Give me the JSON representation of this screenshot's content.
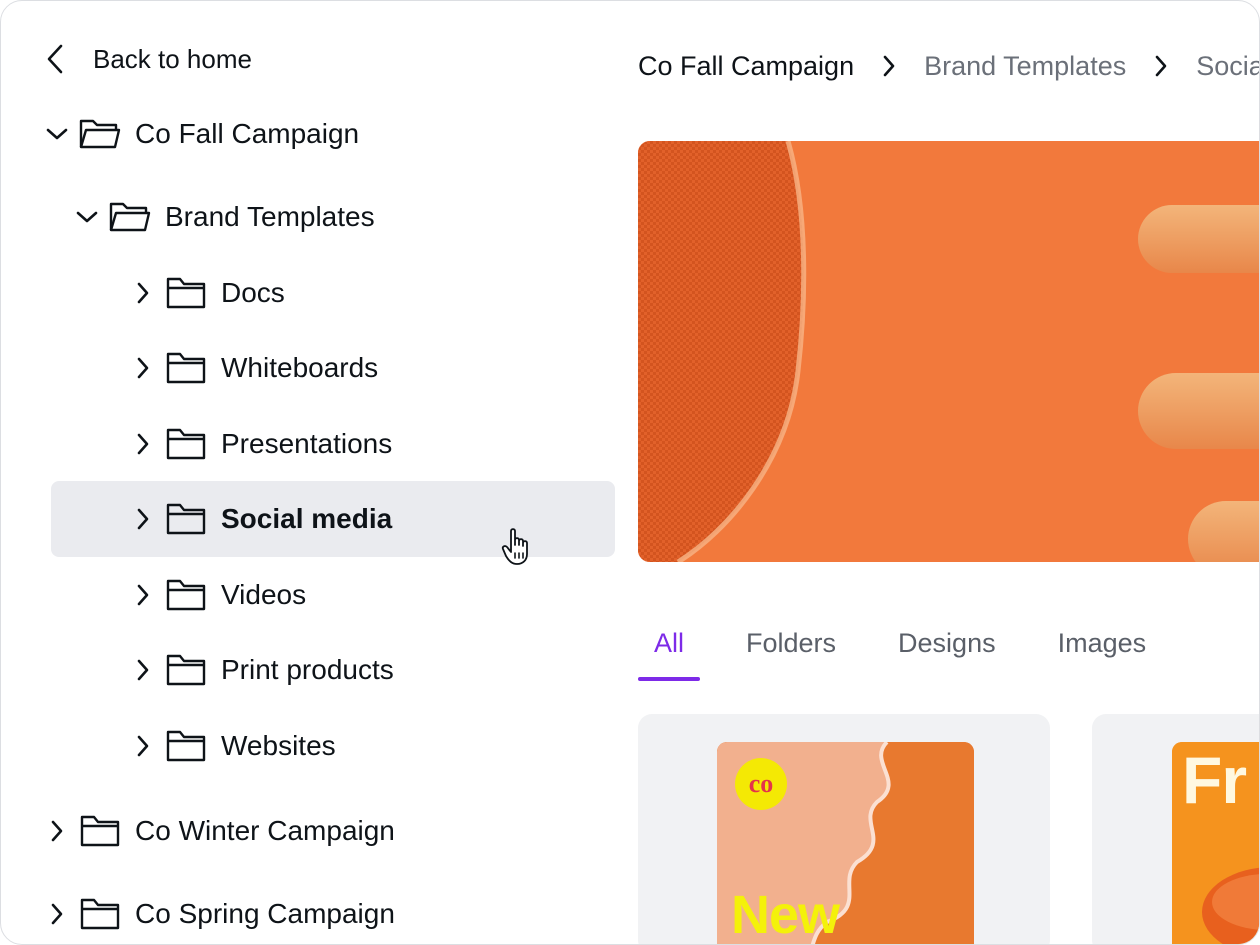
{
  "sidebar": {
    "back_label": "Back to home",
    "tree": [
      {
        "label": "Co Fall Campaign",
        "expanded": true,
        "icon": "folder-open-icon"
      },
      {
        "label": "Brand Templates",
        "expanded": true,
        "icon": "folder-open-icon"
      },
      {
        "label": "Docs",
        "icon": "folder-icon"
      },
      {
        "label": "Whiteboards",
        "icon": "folder-icon"
      },
      {
        "label": "Presentations",
        "icon": "folder-icon"
      },
      {
        "label": "Social media",
        "icon": "folder-icon",
        "active": true
      },
      {
        "label": "Videos",
        "icon": "folder-icon"
      },
      {
        "label": "Print products",
        "icon": "folder-icon"
      },
      {
        "label": "Websites",
        "icon": "folder-icon"
      },
      {
        "label": "Co Winter Campaign",
        "icon": "folder-icon"
      },
      {
        "label": "Co Spring Campaign",
        "icon": "folder-icon"
      }
    ]
  },
  "breadcrumb": [
    "Co Fall Campaign",
    "Brand Templates",
    "Social media"
  ],
  "tabs": [
    {
      "label": "All",
      "active": true
    },
    {
      "label": "Folders"
    },
    {
      "label": "Designs"
    },
    {
      "label": "Images"
    }
  ],
  "cards": [
    {
      "text": "New",
      "logo_text": "co"
    },
    {
      "text": "Fr"
    }
  ],
  "colors": {
    "accent": "#7d2ae8",
    "active_row": "#eaebef",
    "hero_orange": "#f2793c",
    "logo_yellow": "#f4e904"
  }
}
